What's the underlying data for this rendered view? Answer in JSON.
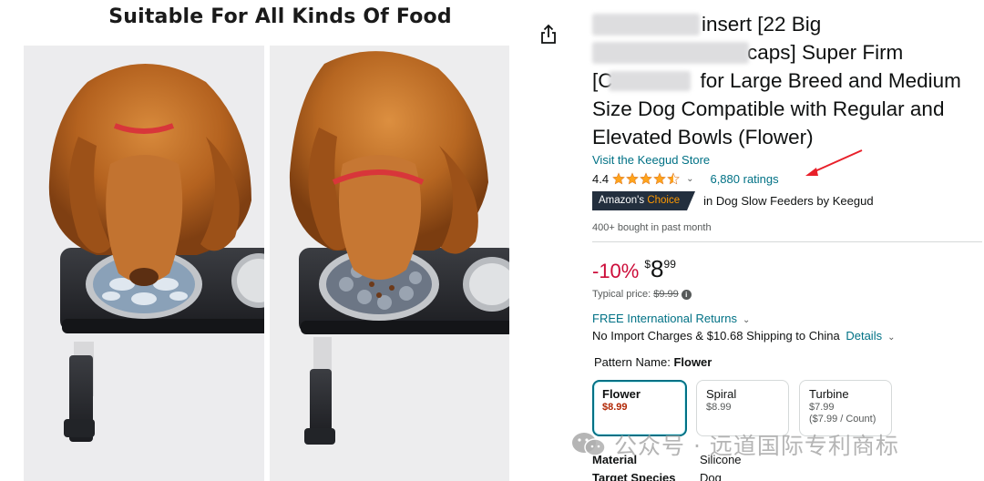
{
  "gallery": {
    "heading": "Suitable For All Kinds Of Food"
  },
  "share": {
    "icon": "share-icon"
  },
  "product": {
    "title_visible": "Insert [22 Big Cups] Super Firm [C] for Large Breed and Medium Size Dog Compatible with Regular and Elevated Bowls (Flower)",
    "title_lines": [
      "insert [22 Big",
      "caps] Super Firm",
      "for Large Breed and Medium",
      "Size Dog Compatible with Regular and",
      "Elevated Bowls (Flower)"
    ],
    "title_line3_prefix": "[C",
    "store_link": "Visit the Keegud Store",
    "rating": "4.4",
    "rating_value": 4.4,
    "ratings_count": "6,880 ratings",
    "badge": {
      "prefix": "Amazon's ",
      "accent": "Choice"
    },
    "badge_category": "in Dog Slow Feeders by Keegud",
    "bought": "400+ bought in past month",
    "price": {
      "discount": "-10%",
      "currency": "$",
      "whole": "8",
      "fraction": "99",
      "typical_label": "Typical price:",
      "typical_value": "$9.99"
    },
    "returns": "FREE International Returns",
    "import_text": "No Import Charges & $10.68 Shipping to China",
    "import_details": "Details",
    "pattern_label": "Pattern Name:",
    "pattern_value": "Flower",
    "swatches": [
      {
        "name": "Flower",
        "price": "$8.99",
        "extra": ""
      },
      {
        "name": "Spiral",
        "price": "$8.99",
        "extra": ""
      },
      {
        "name": "Turbine",
        "price": "$7.99",
        "extra": "($7.99 / Count)"
      }
    ],
    "specs": [
      {
        "key": "Material",
        "value": "Silicone"
      },
      {
        "key": "Target Species",
        "value": "Dog"
      }
    ]
  },
  "watermark": "公众号 · 远道国际专利商标",
  "colors": {
    "link": "#007185",
    "discount": "#cc0c39",
    "star": "#ffa41c",
    "badge_bg": "#232f3e",
    "badge_accent": "#ff9900",
    "arrow": "#e8202a"
  }
}
